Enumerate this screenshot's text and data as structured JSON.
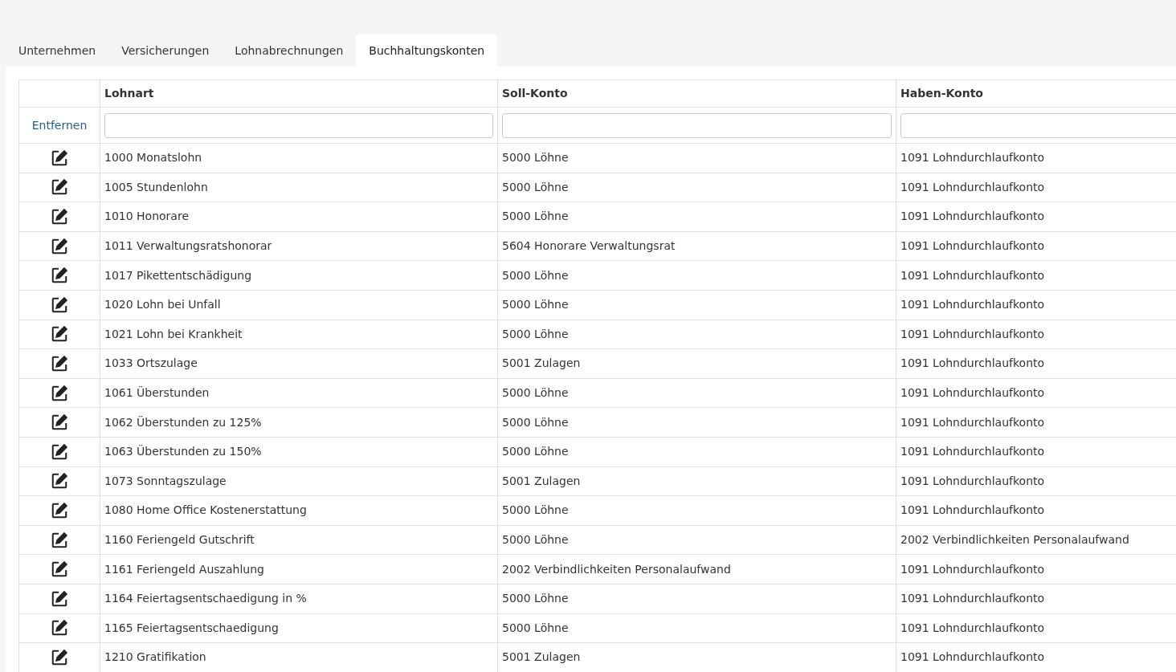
{
  "tabs": [
    {
      "label": "Unternehmen",
      "selected": false
    },
    {
      "label": "Versicherungen",
      "selected": false
    },
    {
      "label": "Lohnabrechnungen",
      "selected": false
    },
    {
      "label": "Buchhaltungskonten",
      "selected": true
    }
  ],
  "table": {
    "columns": [
      "Lohnart",
      "Soll-Konto",
      "Haben-Konto"
    ],
    "filter_row": {
      "remove_link": "Entfernen"
    },
    "rows": [
      [
        "1000 Monatslohn",
        "5000 Löhne",
        "1091 Lohndurchlaufkonto"
      ],
      [
        "1005 Stundenlohn",
        "5000 Löhne",
        "1091 Lohndurchlaufkonto"
      ],
      [
        "1010 Honorare",
        "5000 Löhne",
        "1091 Lohndurchlaufkonto"
      ],
      [
        "1011 Verwaltungsratshonorar",
        "5604 Honorare Verwaltungsrat",
        "1091 Lohndurchlaufkonto"
      ],
      [
        "1017 Pikettentschädigung",
        "5000 Löhne",
        "1091 Lohndurchlaufkonto"
      ],
      [
        "1020 Lohn bei Unfall",
        "5000 Löhne",
        "1091 Lohndurchlaufkonto"
      ],
      [
        "1021 Lohn bei Krankheit",
        "5000 Löhne",
        "1091 Lohndurchlaufkonto"
      ],
      [
        "1033 Ortszulage",
        "5001 Zulagen",
        "1091 Lohndurchlaufkonto"
      ],
      [
        "1061 Überstunden",
        "5000 Löhne",
        "1091 Lohndurchlaufkonto"
      ],
      [
        "1062 Überstunden zu 125%",
        "5000 Löhne",
        "1091 Lohndurchlaufkonto"
      ],
      [
        "1063 Überstunden zu 150%",
        "5000 Löhne",
        "1091 Lohndurchlaufkonto"
      ],
      [
        "1073 Sonntagszulage",
        "5001 Zulagen",
        "1091 Lohndurchlaufkonto"
      ],
      [
        "1080 Home Office Kostenerstattung",
        "5000 Löhne",
        "1091 Lohndurchlaufkonto"
      ],
      [
        "1160 Feriengeld Gutschrift",
        "5000 Löhne",
        "2002 Verbindlichkeiten Personalaufwand"
      ],
      [
        "1161 Feriengeld Auszahlung",
        "2002 Verbindlichkeiten Personalaufwand",
        "1091 Lohndurchlaufkonto"
      ],
      [
        "1164 Feiertagsentschaedigung in %",
        "5000 Löhne",
        "1091 Lohndurchlaufkonto"
      ],
      [
        "1165 Feiertagsentschaedigung",
        "5000 Löhne",
        "1091 Lohndurchlaufkonto"
      ],
      [
        "1210 Gratifikation",
        "5001 Zulagen",
        "1091 Lohndurchlaufkonto"
      ]
    ]
  }
}
